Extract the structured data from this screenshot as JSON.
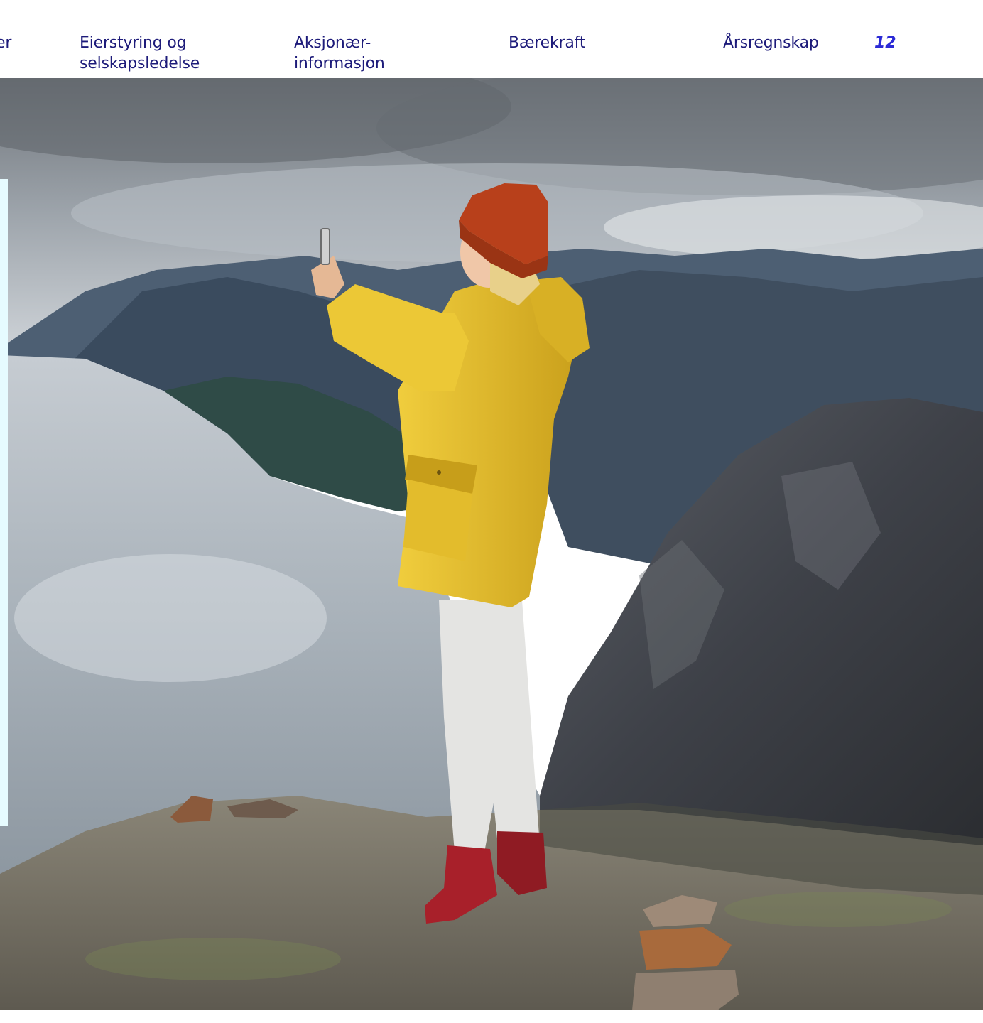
{
  "nav": {
    "cut_item": "er",
    "items": [
      {
        "id": "eierstyring",
        "label": "Eierstyring og\nselskapsledelse"
      },
      {
        "id": "aksjonaer",
        "label": "Aksjonær-\ninformasjon"
      },
      {
        "id": "baerekraft",
        "label": "Bærekraft"
      },
      {
        "id": "arsregnskap",
        "label": "Årsregnskap"
      }
    ]
  },
  "page_number": "12",
  "colors": {
    "nav_text": "#1d1b7a",
    "page_number": "#2b2ad6",
    "panel_edge": "#e6fbff",
    "jacket": "#e7c02e",
    "beanie": "#b8401b",
    "boots": "#a8202a"
  },
  "photo": {
    "subject": "hiker-taking-photo",
    "icons": [
      "mountain-photo"
    ]
  }
}
